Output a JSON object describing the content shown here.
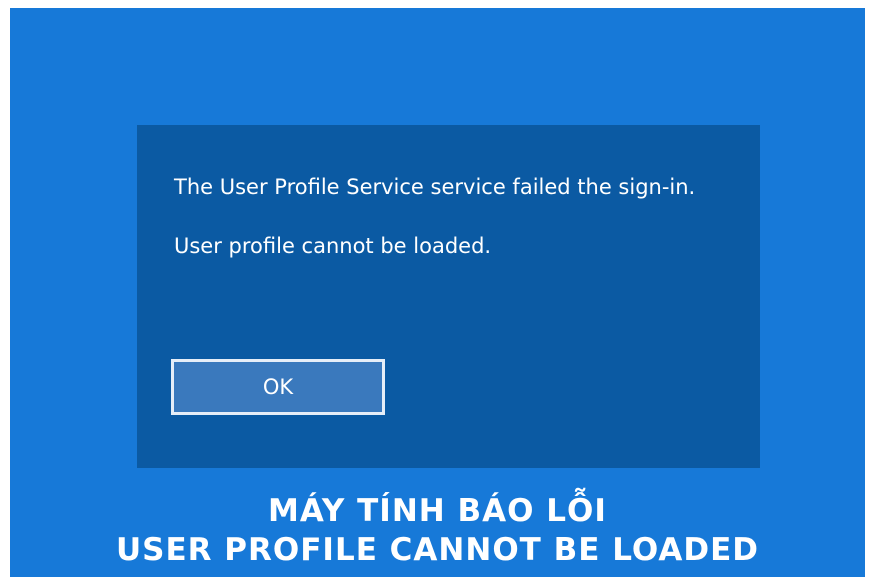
{
  "dialog": {
    "message_line1": "The User Profile Service service failed the sign-in.",
    "message_line2": "User profile cannot be loaded.",
    "ok_label": "OK"
  },
  "caption": {
    "line1": "MÁY TÍNH BÁO LỖI",
    "line2": "USER PROFILE CANNOT BE LOADED"
  },
  "colors": {
    "screen_background": "#1779d8",
    "dialog_background": "#0b5aa3",
    "button_fill": "#3a79bd",
    "text": "#ffffff"
  }
}
